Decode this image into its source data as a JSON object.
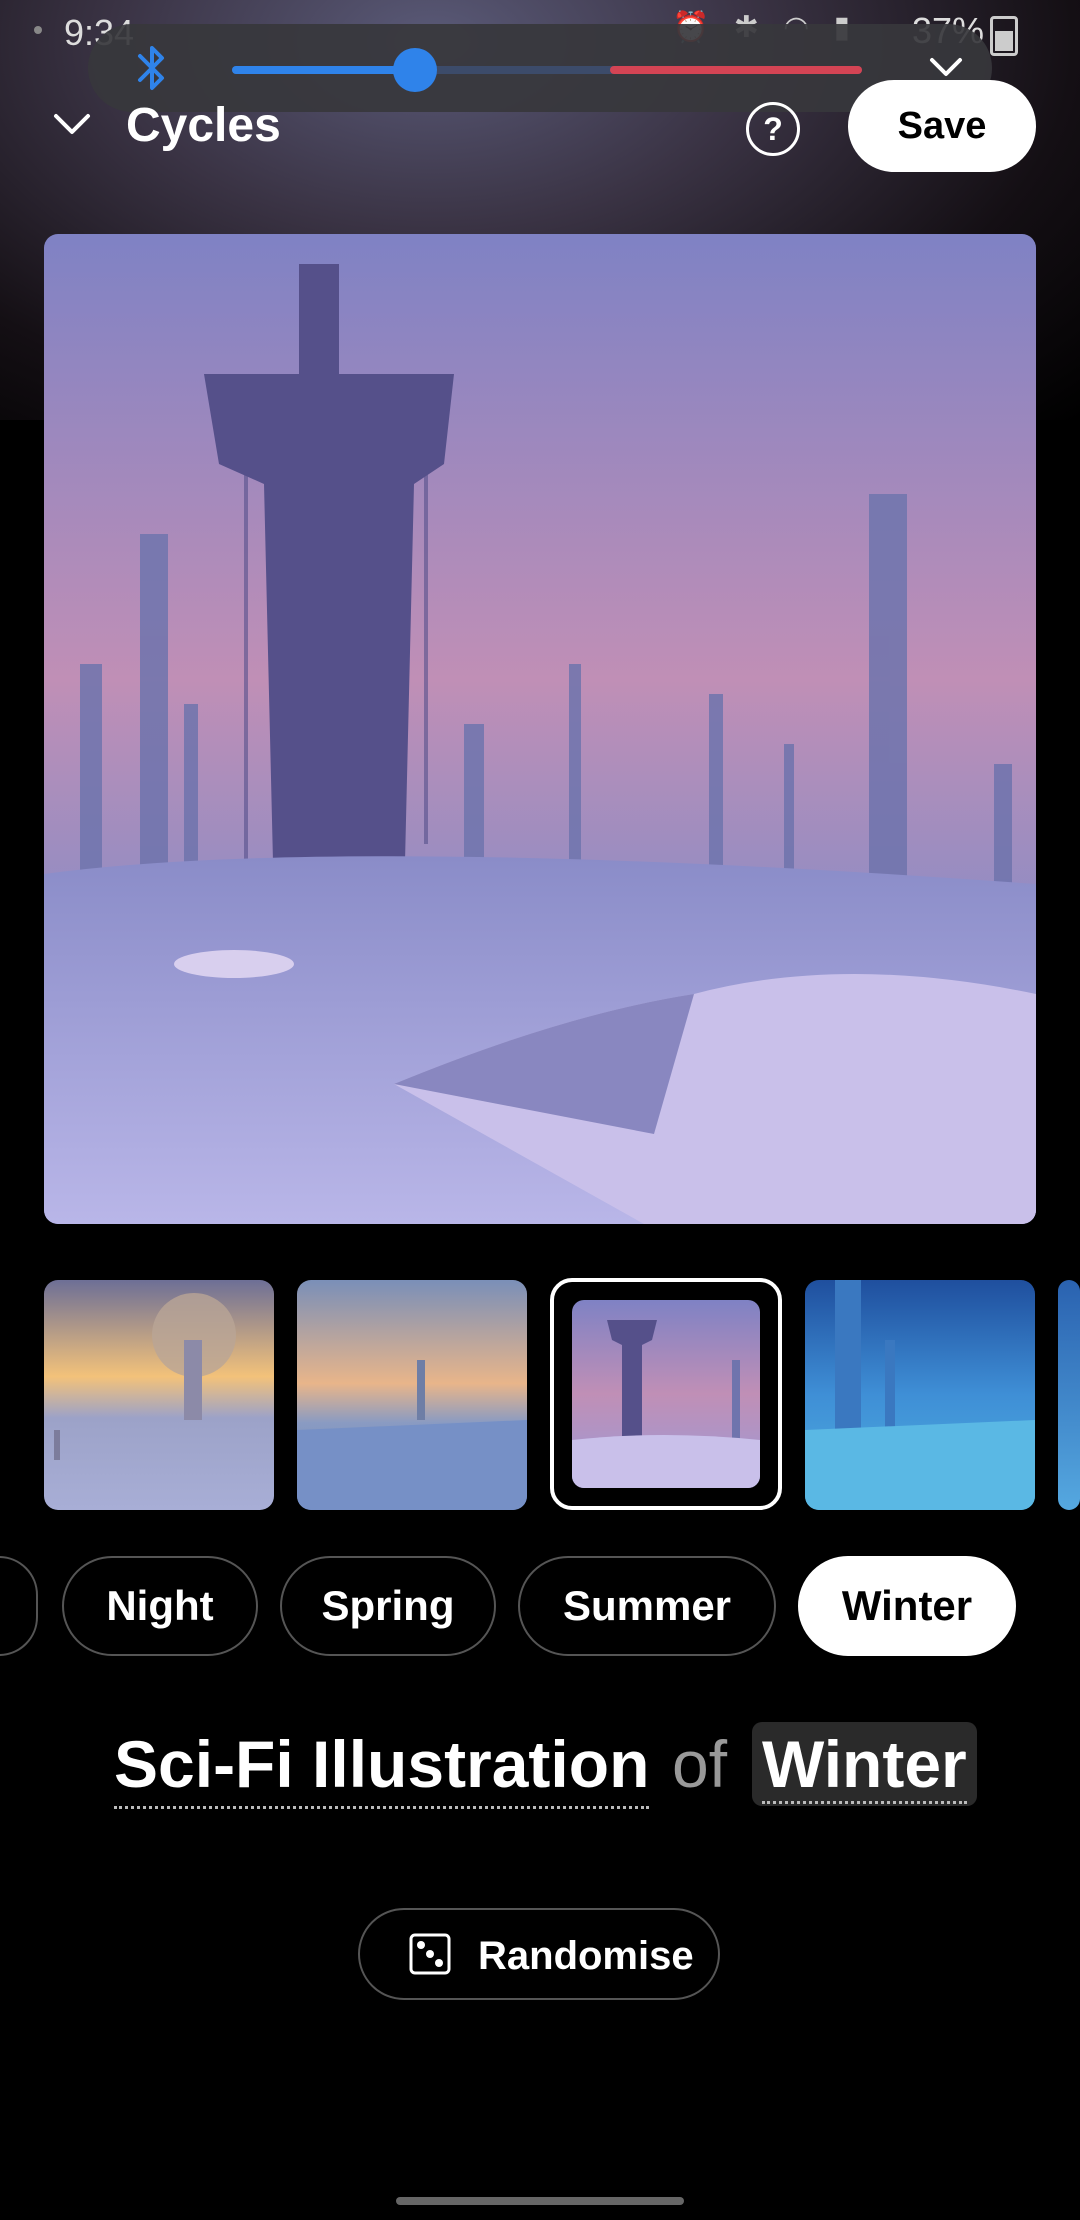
{
  "status_bar": {
    "time": "9:34",
    "battery": "37%",
    "icons": [
      "alarm-icon",
      "bluetooth-icon",
      "wifi-icon",
      "signal-icon",
      "battery-icon"
    ]
  },
  "volume_panel": {
    "level": 0.29,
    "danger_from": 0.6,
    "accent_color": "#2f83ea",
    "danger_color": "#d44454"
  },
  "header": {
    "title": "Cycles",
    "help_label": "?",
    "save_label": "Save"
  },
  "chips": [
    "Night",
    "Spring",
    "Summer",
    "Winter"
  ],
  "selected_chip": "Winter",
  "prompt": {
    "style": "Sci-Fi Illustration",
    "connector": "of",
    "subject": "Winter"
  },
  "randomise_label": "Randomise"
}
